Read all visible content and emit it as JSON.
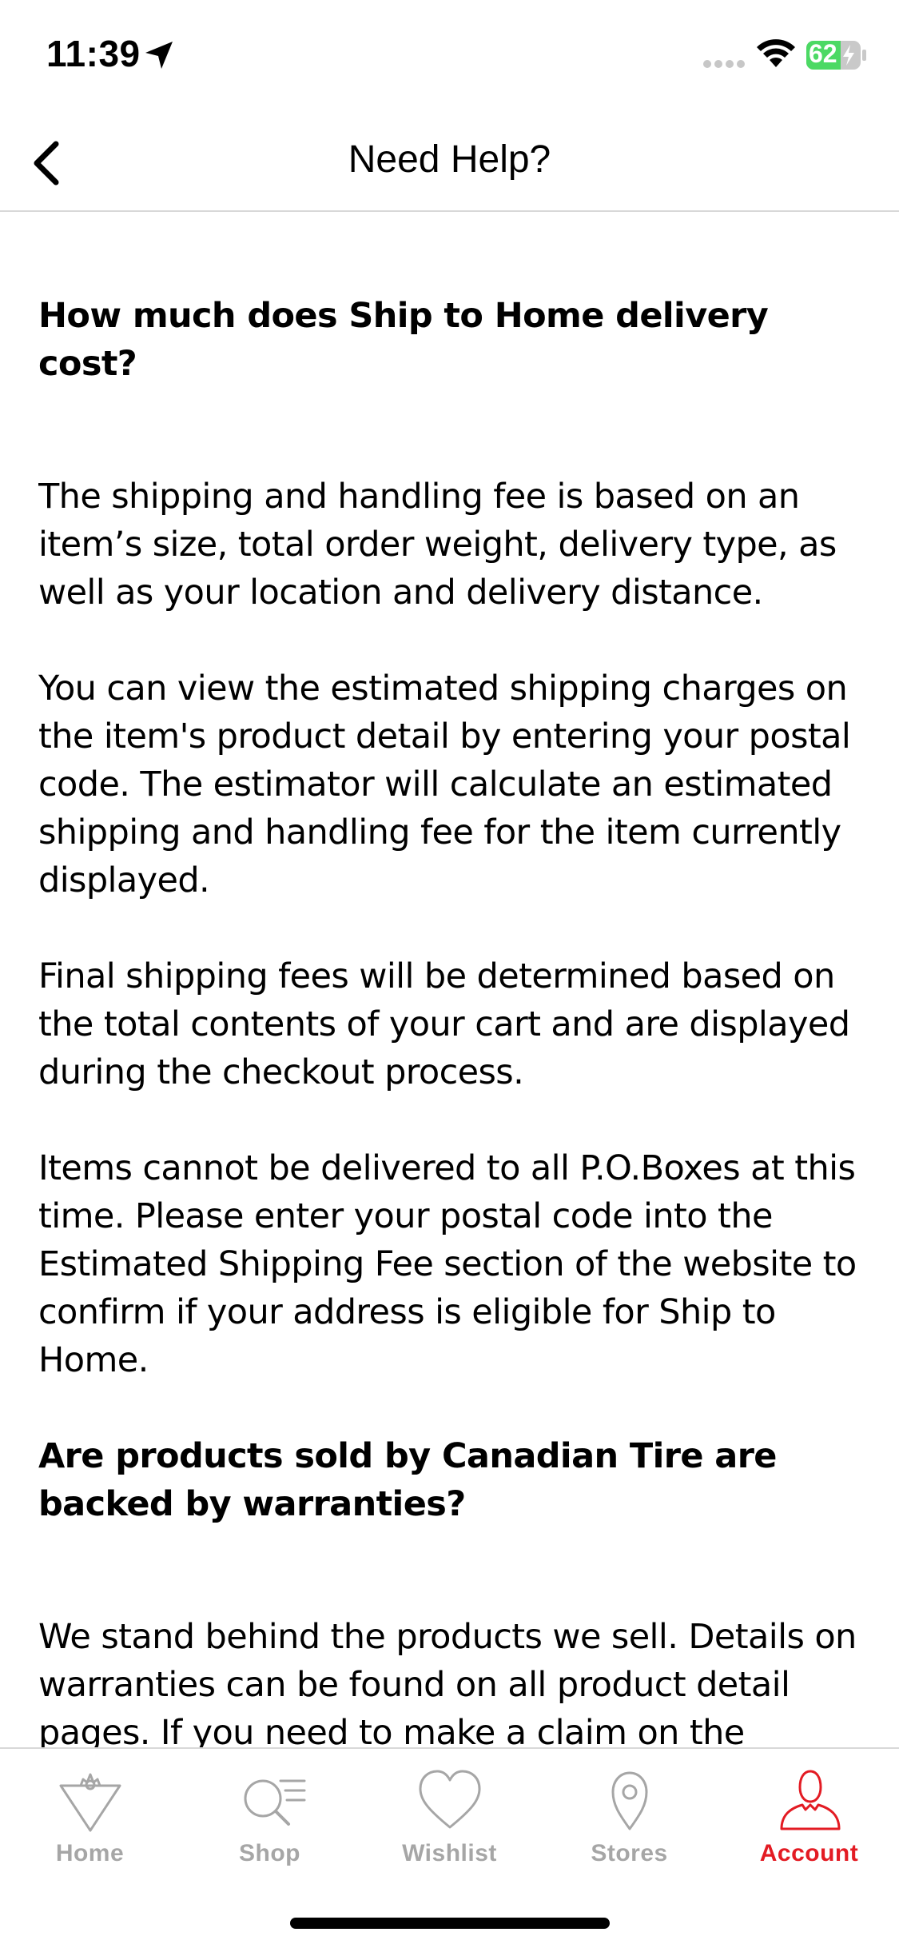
{
  "status_bar": {
    "time": "11:39",
    "battery": "62"
  },
  "header": {
    "title": "Need Help?"
  },
  "faq": [
    {
      "question": "How much does Ship to Home delivery cost?",
      "answers": [
        "The shipping and handling fee is based on an item’s size, total order weight, delivery type, as well as your location and delivery distance.",
        "You can view the estimated shipping charges on the item's product detail by entering your postal code. The estimator will calculate an estimated shipping and handling fee for the item currently displayed.",
        "Final shipping fees will be determined based on the total contents of your cart and are displayed during the checkout process.",
        "Items cannot be delivered to all P.O.Boxes at this time. Please enter your postal code into the Estimated Shipping Fee section of the website to confirm if your address is eligible for Ship to Home."
      ]
    },
    {
      "question": "Are products sold by Canadian Tire are backed by warranties?",
      "answers": [
        "We stand behind the products we sell. Details on warranties can be found on all product detail pages. If you need to make a claim on the"
      ]
    }
  ],
  "tabs": [
    {
      "label": "Home",
      "icon": "home-icon",
      "active": false
    },
    {
      "label": "Shop",
      "icon": "shop-search-icon",
      "active": false
    },
    {
      "label": "Wishlist",
      "icon": "heart-icon",
      "active": false
    },
    {
      "label": "Stores",
      "icon": "location-pin-icon",
      "active": false
    },
    {
      "label": "Account",
      "icon": "account-person-icon",
      "active": true
    }
  ],
  "colors": {
    "accent": "#e31b23",
    "inactive_tab": "#a6a6a6",
    "battery": "#4cd964",
    "divider": "#d8d8d8"
  }
}
